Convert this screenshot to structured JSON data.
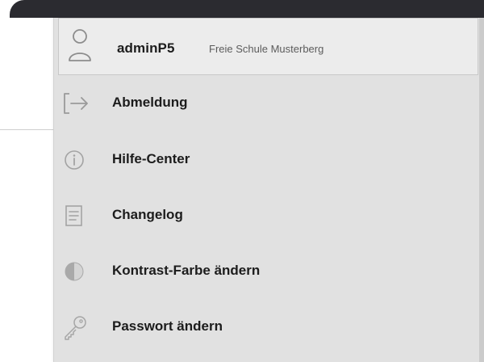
{
  "user": {
    "name": "adminP5",
    "organization": "Freie Schule Musterberg"
  },
  "menu": {
    "items": [
      {
        "label": "Abmeldung",
        "icon": "logout-icon"
      },
      {
        "label": "Hilfe-Center",
        "icon": "info-icon"
      },
      {
        "label": "Changelog",
        "icon": "document-icon"
      },
      {
        "label": "Kontrast-Farbe ändern",
        "icon": "contrast-icon"
      },
      {
        "label": "Passwort ändern",
        "icon": "key-icon"
      }
    ]
  },
  "colors": {
    "topbar": "#2b2b30",
    "menu_background": "#e1e1e1",
    "header_background": "#ececec",
    "icon": "#9a9a9a",
    "text": "#1c1c1c"
  }
}
